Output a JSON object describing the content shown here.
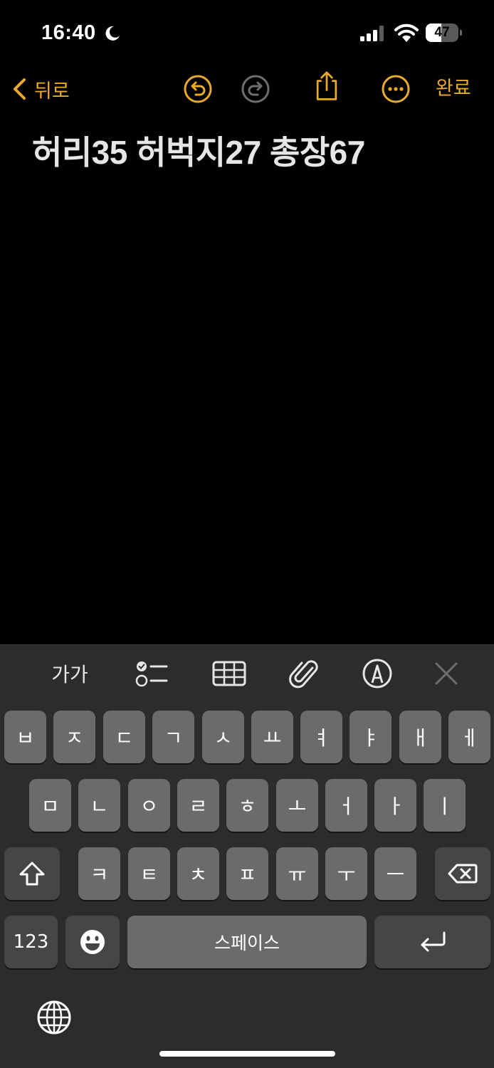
{
  "status_bar": {
    "time": "16:40",
    "battery_level": "47",
    "battery_fraction": 0.47,
    "icons": [
      "moon-icon",
      "signal-icon",
      "wifi-icon",
      "battery-icon"
    ]
  },
  "nav": {
    "back_label": "뒤로",
    "done_label": "완료",
    "icons": [
      "chevron-left-icon",
      "undo-icon",
      "redo-icon",
      "share-icon",
      "more-icon"
    ]
  },
  "note": {
    "text": "허리35 허벅지27 총장67"
  },
  "format_toolbar": {
    "text_style_label": "가가",
    "icons": [
      "checklist-icon",
      "table-icon",
      "paperclip-icon",
      "markup-icon",
      "close-icon"
    ]
  },
  "keyboard": {
    "row1": [
      "ㅂ",
      "ㅈ",
      "ㄷ",
      "ㄱ",
      "ㅅ",
      "ㅛ",
      "ㅕ",
      "ㅑ",
      "ㅐ",
      "ㅔ"
    ],
    "row2": [
      "ㅁ",
      "ㄴ",
      "ㅇ",
      "ㄹ",
      "ㅎ",
      "ㅗ",
      "ㅓ",
      "ㅏ",
      "ㅣ"
    ],
    "row3": [
      "ㅋ",
      "ㅌ",
      "ㅊ",
      "ㅍ",
      "ㅠ",
      "ㅜ",
      "ㅡ"
    ],
    "numbers_label": "123",
    "space_label": "스페이스",
    "icons": [
      "shift-icon",
      "delete-icon",
      "emoji-icon",
      "return-icon",
      "globe-icon"
    ]
  },
  "colors": {
    "accent": "#e9a929",
    "background": "#000000",
    "keyboard_bg": "#2c2c2e",
    "key_bg": "#6b6b6b",
    "special_key_bg": "#464648"
  }
}
